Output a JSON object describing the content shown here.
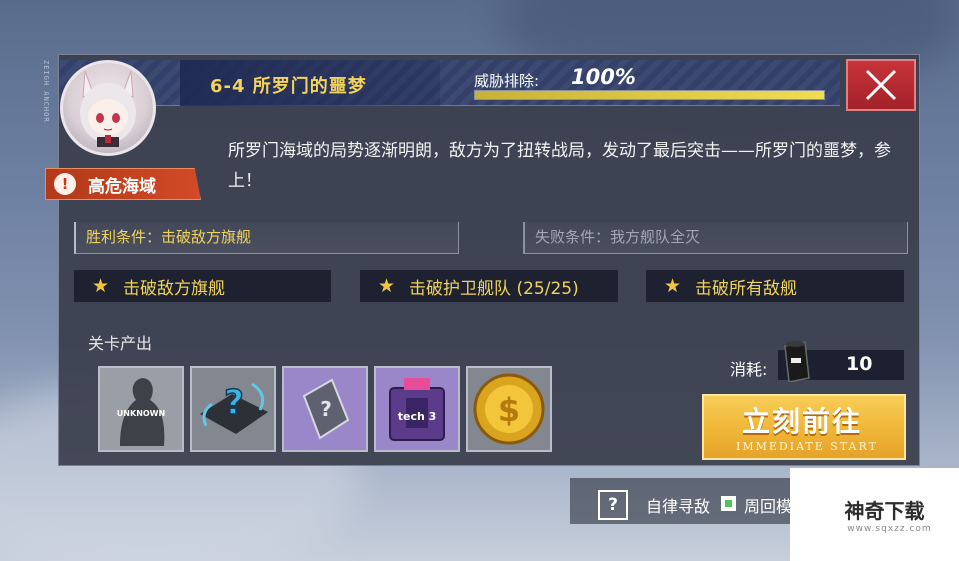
{
  "side_rail_text": "ZEIGH ANCHOR",
  "stage": {
    "title": "6-4 所罗门的噩梦"
  },
  "threat": {
    "label": "威胁排除:",
    "value": "100%",
    "progress": 1.0
  },
  "danger_badge": {
    "label": "高危海域",
    "icon": "!"
  },
  "description": "所罗门海域的局势逐渐明朗，敌方为了扭转战局，发动了最后突击——所罗门的噩梦，参上！",
  "conditions": {
    "win": "胜利条件：击破敌方旗舰",
    "fail": "失败条件：我方舰队全灭"
  },
  "objectives": [
    {
      "label": "击破敌方旗舰"
    },
    {
      "label": "击破护卫舰队 (25/25)"
    },
    {
      "label": "击破所有敌舰"
    }
  ],
  "drops": {
    "title": "关卡产出",
    "items": [
      {
        "name": "unknown",
        "label": "UNKNOWN"
      },
      {
        "name": "mystery-blueprint",
        "label": "?"
      },
      {
        "name": "mystery-cube",
        "label": "?"
      },
      {
        "name": "tech-box",
        "label": "tech 3"
      },
      {
        "name": "coin",
        "label": "$"
      }
    ]
  },
  "consume": {
    "label": "消耗:",
    "value": "10",
    "icon": "oil-barrel-icon"
  },
  "go_button": {
    "main": "立刻前往",
    "sub": "IMMEDIATE START"
  },
  "bottom": {
    "help_icon": "?",
    "auto_search": "自律寻敌",
    "cycle_mode": "周回模式"
  },
  "watermark": {
    "title": "神奇下载",
    "url": "www.sqxzz.com"
  },
  "colors": {
    "accent_yellow": "#f0d35b",
    "danger_red": "#c8333a",
    "button_gold": "#efb637"
  }
}
